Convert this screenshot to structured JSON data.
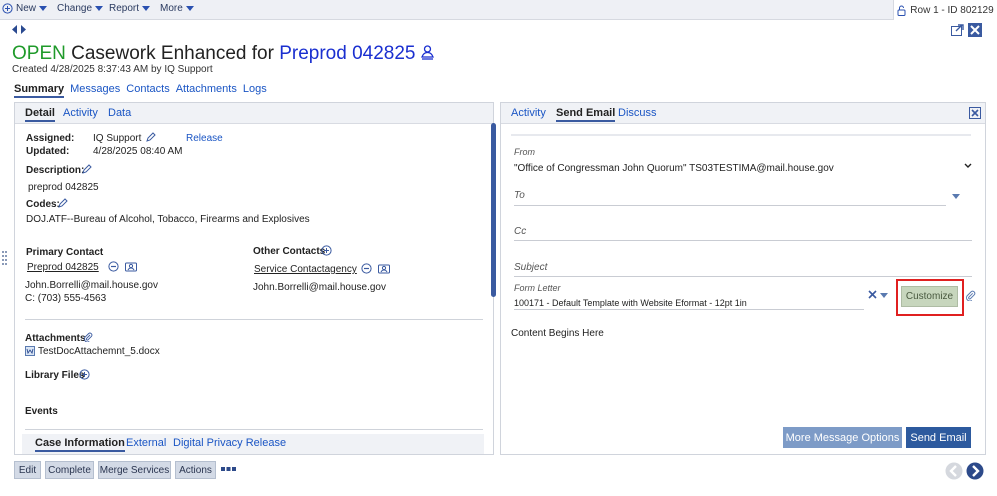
{
  "toolbar": {
    "new_label": "New",
    "change_label": "Change",
    "report_label": "Report",
    "more_label": "More",
    "row_id": "Row 1 - ID 802129"
  },
  "header": {
    "status": "OPEN",
    "title": "Casework Enhanced for",
    "constituent": "Preprod 042825",
    "created": "Created 4/28/2025 8:37:43 AM by IQ Support"
  },
  "main_tabs": [
    "Summary",
    "Messages",
    "Contacts",
    "Attachments",
    "Logs"
  ],
  "left_tabs": [
    "Detail",
    "Activity",
    "Data"
  ],
  "detail": {
    "assigned_label": "Assigned:",
    "assigned_value": "IQ Support",
    "release_label": "Release",
    "updated_label": "Updated:",
    "updated_value": "4/28/2025 08:40 AM",
    "description_label": "Description:",
    "description_value": "preprod 042825",
    "codes_label": "Codes:",
    "codes_value": "DOJ.ATF--Bureau of Alcohol, Tobacco, Firearms and Explosives",
    "primary_contact_label": "Primary Contact",
    "primary_contact_name": "Preprod 042825",
    "primary_contact_email": "John.Borrelli@mail.house.gov",
    "primary_contact_phone": "C: (703) 555-4563",
    "other_contacts_label": "Other Contacts",
    "other_contact_name": "Service Contactagency",
    "other_contact_email": "John.Borrelli@mail.house.gov",
    "attachments_label": "Attachments",
    "attachment_file": "TestDocAttachemnt_5.docx",
    "library_files_label": "Library Files",
    "events_label": "Events"
  },
  "case_info_tabs": [
    "Case Information",
    "External",
    "Digital Privacy Release"
  ],
  "right_tabs": [
    "Activity",
    "Send Email",
    "Discuss"
  ],
  "email": {
    "from_label": "From",
    "from_value": "\"Office of Congressman John Quorum\" TS03TESTIMA@mail.house.gov",
    "to_placeholder": "To",
    "cc_placeholder": "Cc",
    "subject_placeholder": "Subject",
    "form_letter_label": "Form Letter",
    "form_letter_value": "100171 - Default Template with Website Eformat - 12pt 1in",
    "customize_label": "Customize",
    "body_text": "Content Begins Here",
    "more_options_label": "More Message Options",
    "send_label": "Send Email"
  },
  "bottom_actions": [
    "Edit",
    "Complete",
    "Merge Services",
    "Actions"
  ],
  "colors": {
    "status_green": "#1f9a2a",
    "link_blue": "#1a55c4",
    "name_blue": "#1a2fd0",
    "send_button": "#2d5a9e",
    "more_options_button": "#7d9bc7",
    "customize_button": "#c7d6bd",
    "highlight_red": "#e02020"
  }
}
